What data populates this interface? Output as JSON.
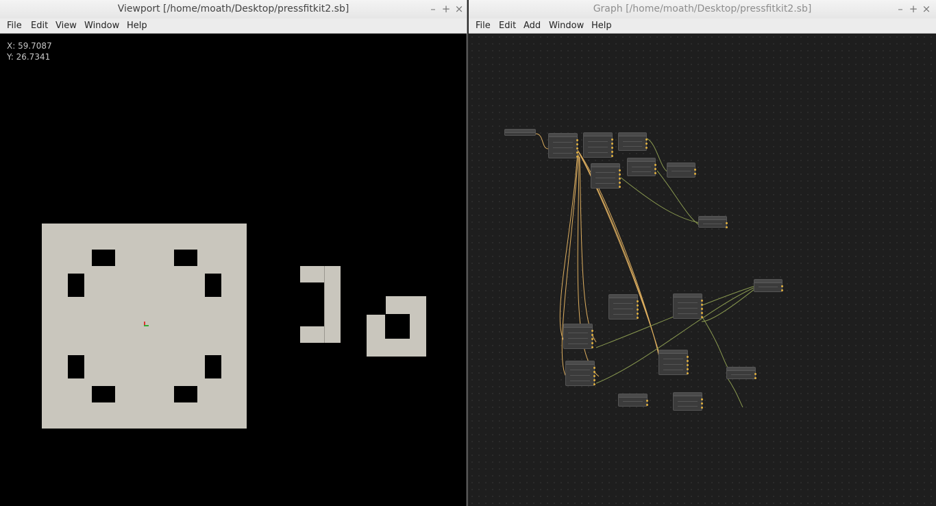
{
  "viewport": {
    "title": "Viewport [/home/moath/Desktop/pressfitkit2.sb]",
    "menu": [
      "File",
      "Edit",
      "View",
      "Window",
      "Help"
    ],
    "coords": {
      "x": "X: 59.7087",
      "y": "Y: 26.7341"
    }
  },
  "graph": {
    "title": "Graph [/home/moath/Desktop/pressfitkit2.sb]",
    "menu": [
      "File",
      "Edit",
      "Add",
      "Window",
      "Help"
    ]
  },
  "window_controls": {
    "minimize": "–",
    "maximize": "+",
    "close": "×"
  },
  "colors": {
    "panel": "#c9c6bd",
    "wire_orange": "#e0b060",
    "wire_green": "#8a9a50",
    "node_body": "#3b3b3b"
  }
}
